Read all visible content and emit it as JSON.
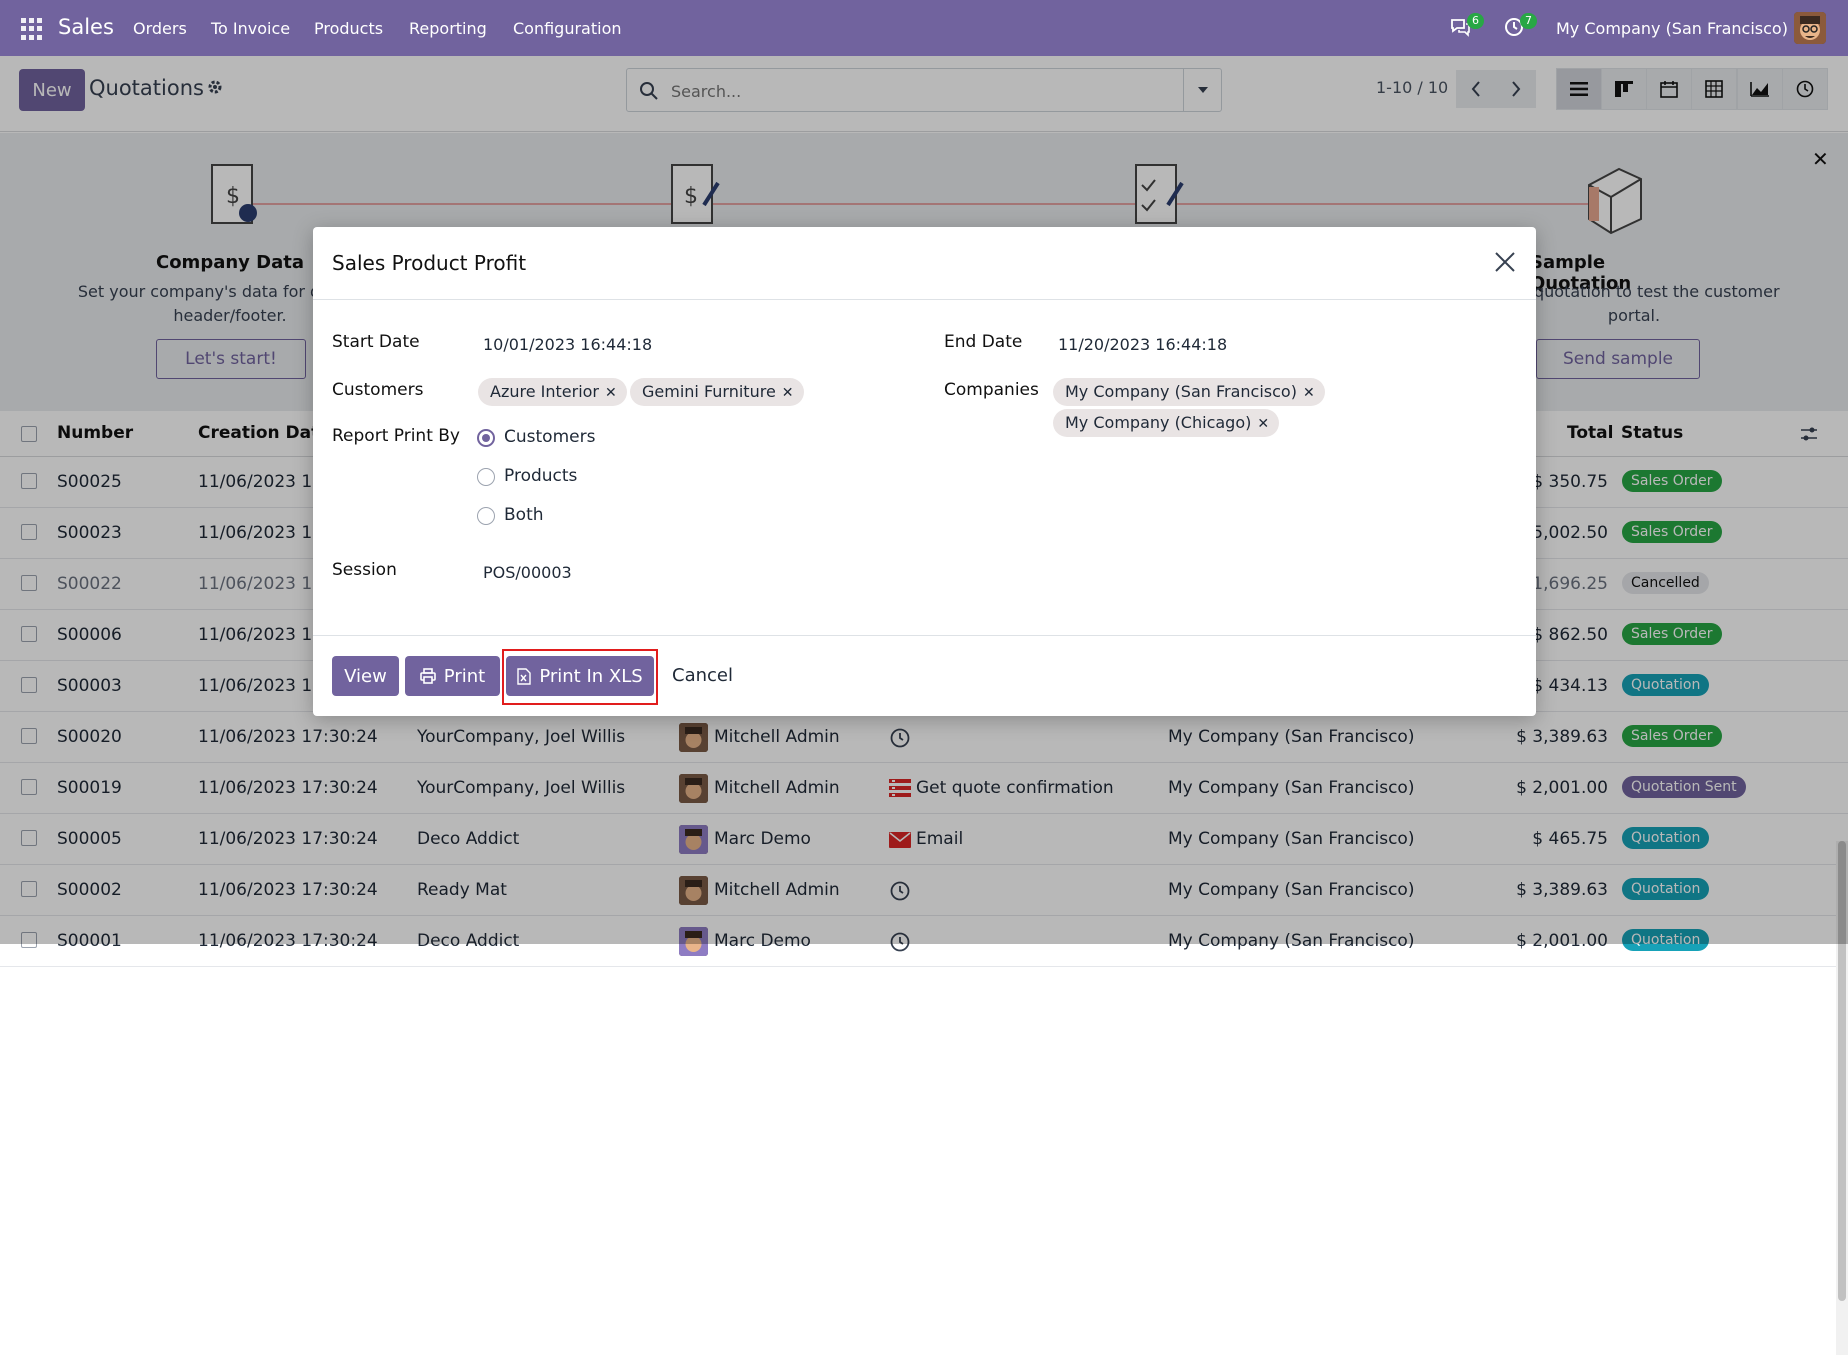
{
  "topbar": {
    "app_name": "Sales",
    "menu": [
      "Orders",
      "To Invoice",
      "Products",
      "Reporting",
      "Configuration"
    ],
    "messages_count": "6",
    "activities_count": "7",
    "company": "My Company (San Francisco)",
    "colors": {
      "brand": "#71639e"
    }
  },
  "control_panel": {
    "new_label": "New",
    "title": "Quotations",
    "search_placeholder": "Search...",
    "pager": "1-10 / 10",
    "views": [
      "list-icon",
      "kanban-icon",
      "calendar-icon",
      "pivot-icon",
      "graph-icon",
      "activity-icon"
    ]
  },
  "helper": {
    "steps": [
      {
        "title": "Company Data",
        "desc1": "Set your company's data for do",
        "desc2": "header/footer.",
        "button": "Let's start!"
      },
      {
        "title": "Sample Quotation",
        "desc1": "quotation to test the customer",
        "desc2": "portal.",
        "button": "Send sample"
      }
    ]
  },
  "list": {
    "headers": {
      "number": "Number",
      "creation_date": "Creation Date",
      "total": "Total",
      "status": "Status"
    },
    "rows": [
      {
        "number": "S00025",
        "date": "11/06/2023 17",
        "customer": "",
        "salesperson": "",
        "activity": "",
        "company": "",
        "total": "$ 350.75",
        "status": "Sales Order"
      },
      {
        "number": "S00023",
        "date": "11/06/2023 17",
        "customer": "",
        "salesperson": "",
        "activity": "",
        "company": "",
        "total": "5,002.50",
        "status": "Sales Order"
      },
      {
        "number": "S00022",
        "date": "11/06/2023 17",
        "customer": "",
        "salesperson": "",
        "activity": "",
        "company": "",
        "total": "1,696.25",
        "status": "Cancelled"
      },
      {
        "number": "S00006",
        "date": "11/06/2023 17",
        "customer": "",
        "salesperson": "",
        "activity": "",
        "company": "",
        "total": "$ 862.50",
        "status": "Sales Order"
      },
      {
        "number": "S00003",
        "date": "11/06/2023 17",
        "customer": "",
        "salesperson": "",
        "activity": "",
        "company": "",
        "total": "$ 434.13",
        "status": "Quotation"
      },
      {
        "number": "S00020",
        "date": "11/06/2023 17:30:24",
        "customer": "YourCompany, Joel Willis",
        "salesperson": "Mitchell Admin",
        "activity": "",
        "company": "My Company (San Francisco)",
        "total": "$ 3,389.63",
        "status": "Sales Order"
      },
      {
        "number": "S00019",
        "date": "11/06/2023 17:30:24",
        "customer": "YourCompany, Joel Willis",
        "salesperson": "Mitchell Admin",
        "activity": "Get quote confirmation",
        "company": "My Company (San Francisco)",
        "total": "$ 2,001.00",
        "status": "Quotation Sent"
      },
      {
        "number": "S00005",
        "date": "11/06/2023 17:30:24",
        "customer": "Deco Addict",
        "salesperson": "Marc Demo",
        "activity": "Email",
        "company": "My Company (San Francisco)",
        "total": "$ 465.75",
        "status": "Quotation"
      },
      {
        "number": "S00002",
        "date": "11/06/2023 17:30:24",
        "customer": "Ready Mat",
        "salesperson": "Mitchell Admin",
        "activity": "",
        "company": "My Company (San Francisco)",
        "total": "$ 3,389.63",
        "status": "Quotation"
      },
      {
        "number": "S00001",
        "date": "11/06/2023 17:30:24",
        "customer": "Deco Addict",
        "salesperson": "Marc Demo",
        "activity": "",
        "company": "My Company (San Francisco)",
        "total": "$ 2,001.00",
        "status": "Quotation"
      }
    ],
    "status_colors": {
      "Sales Order": "#28a745",
      "Cancelled": "#e5e7eb",
      "Quotation": "#17a2b8",
      "Quotation Sent": "#71639e"
    }
  },
  "dialog": {
    "title": "Sales Product Profit",
    "start_date_label": "Start Date",
    "start_date": "10/01/2023 16:44:18",
    "end_date_label": "End Date",
    "end_date": "11/20/2023 16:44:18",
    "customers_label": "Customers",
    "customers": [
      "Azure Interior",
      "Gemini Furniture"
    ],
    "companies_label": "Companies",
    "companies": [
      "My Company (San Francisco)",
      "My Company (Chicago)"
    ],
    "print_by_label": "Report Print By",
    "print_by_options": [
      "Customers",
      "Products",
      "Both"
    ],
    "print_by_selected": "Customers",
    "session_label": "Session",
    "session": "POS/00003",
    "buttons": {
      "view": "View",
      "print": "Print",
      "print_xls": "Print In XLS",
      "cancel": "Cancel"
    }
  }
}
